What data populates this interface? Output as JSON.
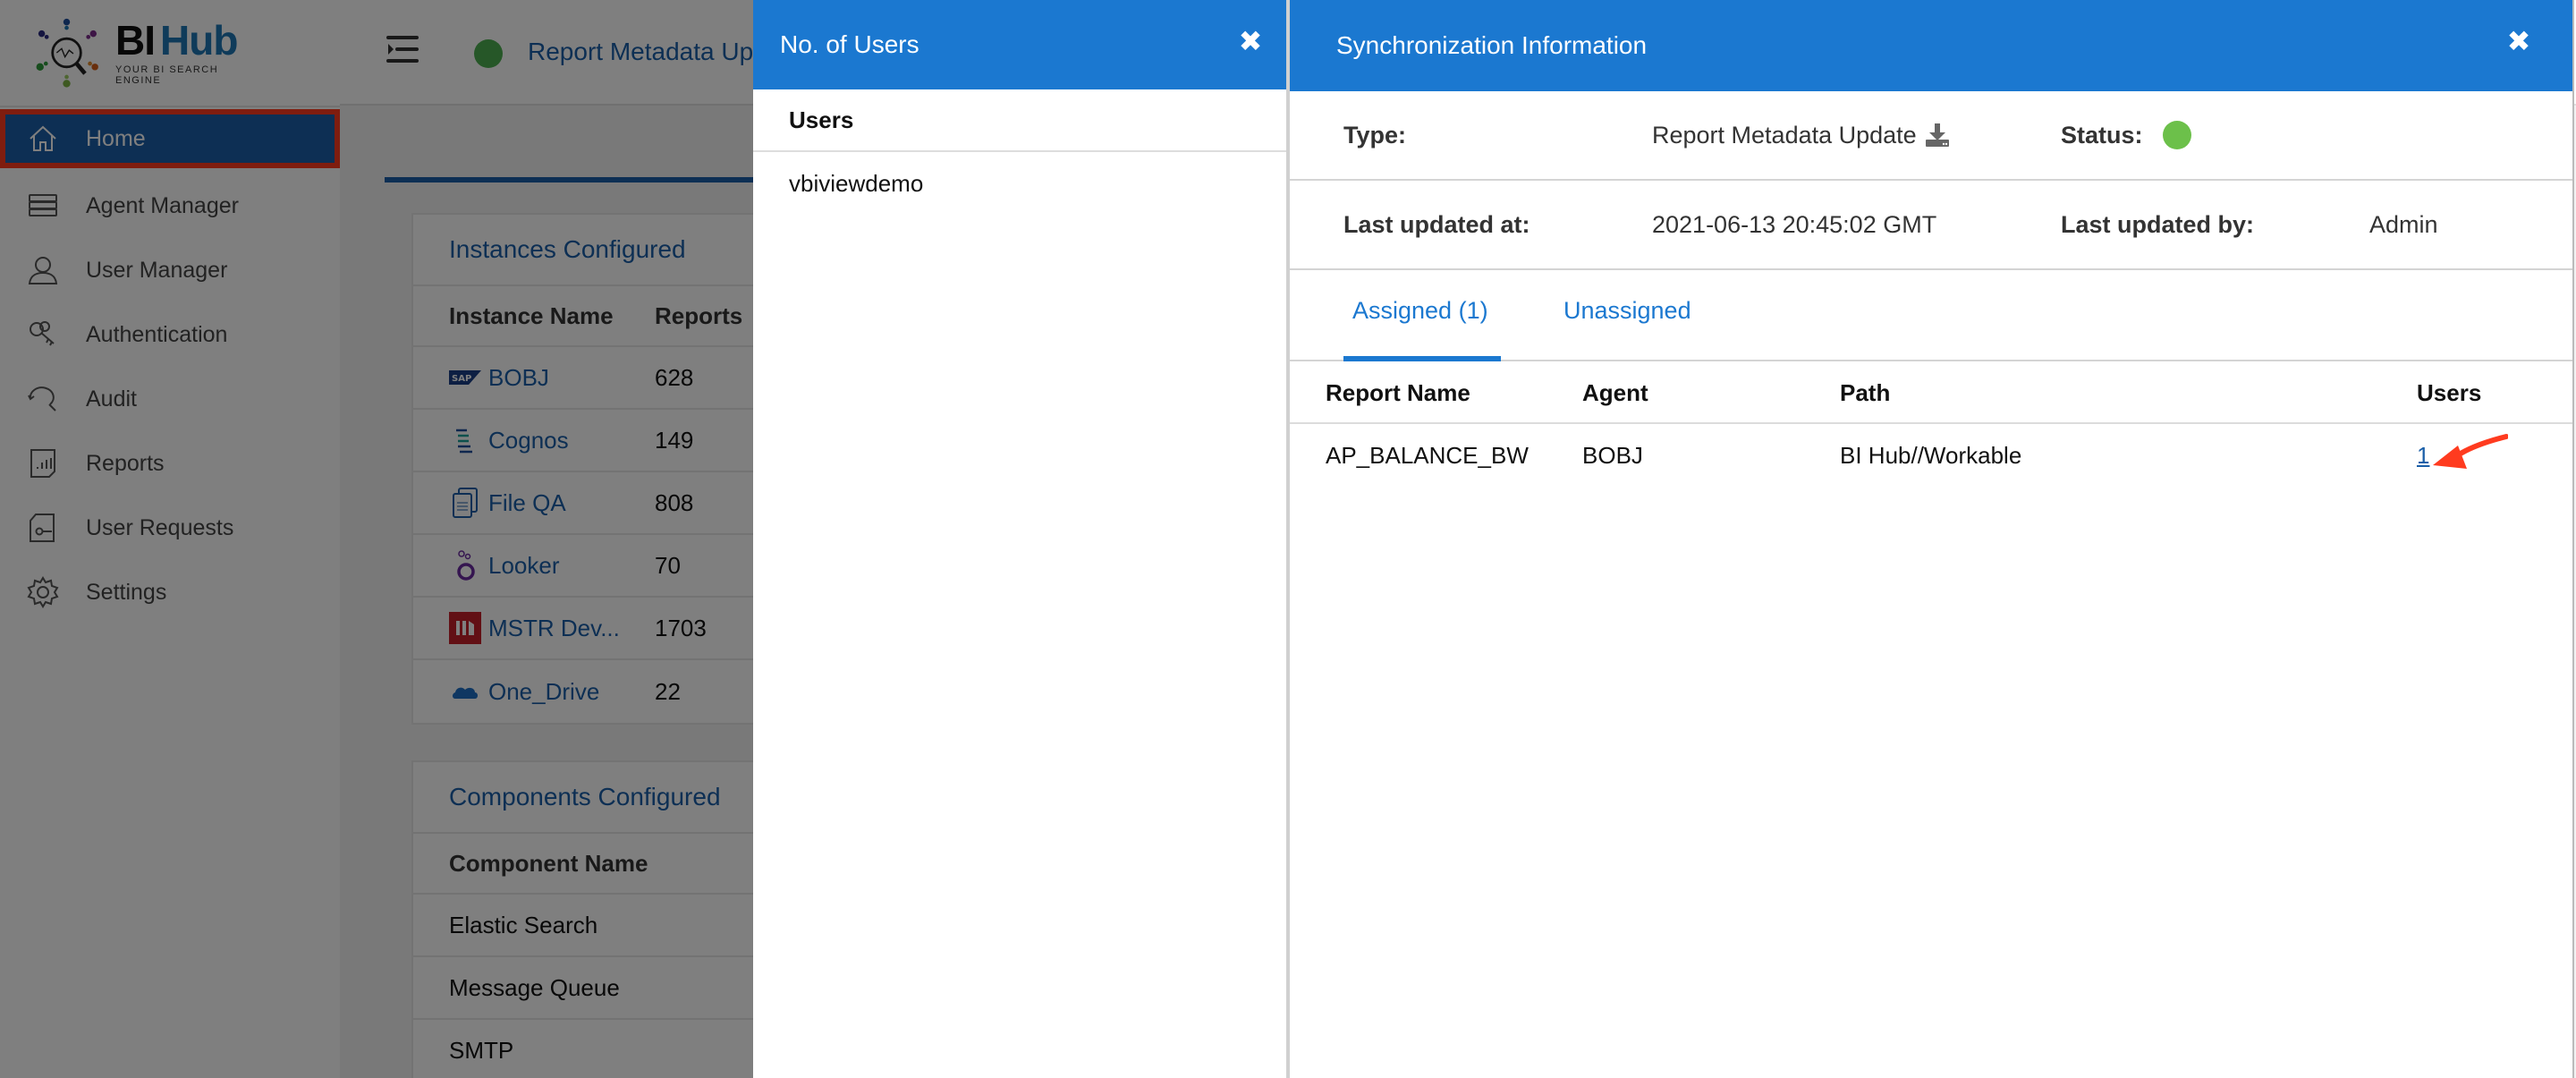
{
  "app": {
    "logo_main_1": "BI",
    "logo_main_2": "Hub",
    "logo_tagline": "YOUR BI SEARCH ENGINE"
  },
  "sidebar": {
    "items": [
      {
        "label": "Home",
        "icon": "home-icon",
        "active": true
      },
      {
        "label": "Agent Manager",
        "icon": "server-icon"
      },
      {
        "label": "User Manager",
        "icon": "user-icon"
      },
      {
        "label": "Authentication",
        "icon": "keys-icon"
      },
      {
        "label": "Audit",
        "icon": "audit-search-icon"
      },
      {
        "label": "Reports",
        "icon": "report-chart-icon"
      },
      {
        "label": "User Requests",
        "icon": "request-key-icon"
      },
      {
        "label": "Settings",
        "icon": "gear-icon"
      }
    ]
  },
  "topbar": {
    "title": "Report Metadata Up",
    "status_color": "#4caf50"
  },
  "instances": {
    "title": "Instances Configured",
    "columns": [
      "Instance Name",
      "Reports"
    ],
    "rows": [
      {
        "name": "BOBJ",
        "reports": "628",
        "icon": "sap-icon"
      },
      {
        "name": "Cognos",
        "reports": "149",
        "icon": "cognos-icon"
      },
      {
        "name": "File QA",
        "reports": "808",
        "icon": "file-icon"
      },
      {
        "name": "Looker",
        "reports": "70",
        "icon": "looker-icon"
      },
      {
        "name": "MSTR Dev...",
        "reports": "1703",
        "icon": "microstrategy-icon"
      },
      {
        "name": "One_Drive",
        "reports": "22",
        "icon": "onedrive-icon"
      }
    ]
  },
  "components": {
    "title": "Components Configured",
    "columns": [
      "Component Name"
    ],
    "rows": [
      "Elastic Search",
      "Message Queue",
      "SMTP"
    ]
  },
  "users_panel": {
    "title": "No. of Users",
    "column": "Users",
    "users": [
      "vbiviewdemo"
    ]
  },
  "sync_panel": {
    "title": "Synchronization Information",
    "type_label": "Type:",
    "type_value": "Report Metadata Update",
    "status_label": "Status:",
    "status_color": "#6cc04a",
    "updated_at_label": "Last updated at:",
    "updated_at_value": "2021-06-13 20:45:02 GMT",
    "updated_by_label": "Last updated by:",
    "updated_by_value": "Admin",
    "tabs": [
      {
        "label": "Assigned (1)",
        "active": true
      },
      {
        "label": "Unassigned",
        "active": false
      }
    ],
    "columns": [
      "Report Name",
      "Agent",
      "Path",
      "Users"
    ],
    "rows": [
      {
        "report_name": "AP_BALANCE_BW",
        "agent": "BOBJ",
        "path": "BI Hub//Workable",
        "users": "1"
      }
    ]
  },
  "colors": {
    "header_blue": "#1b78d0",
    "brand_blue": "#1b5fa8",
    "highlight_red": "#ff3b1f"
  }
}
